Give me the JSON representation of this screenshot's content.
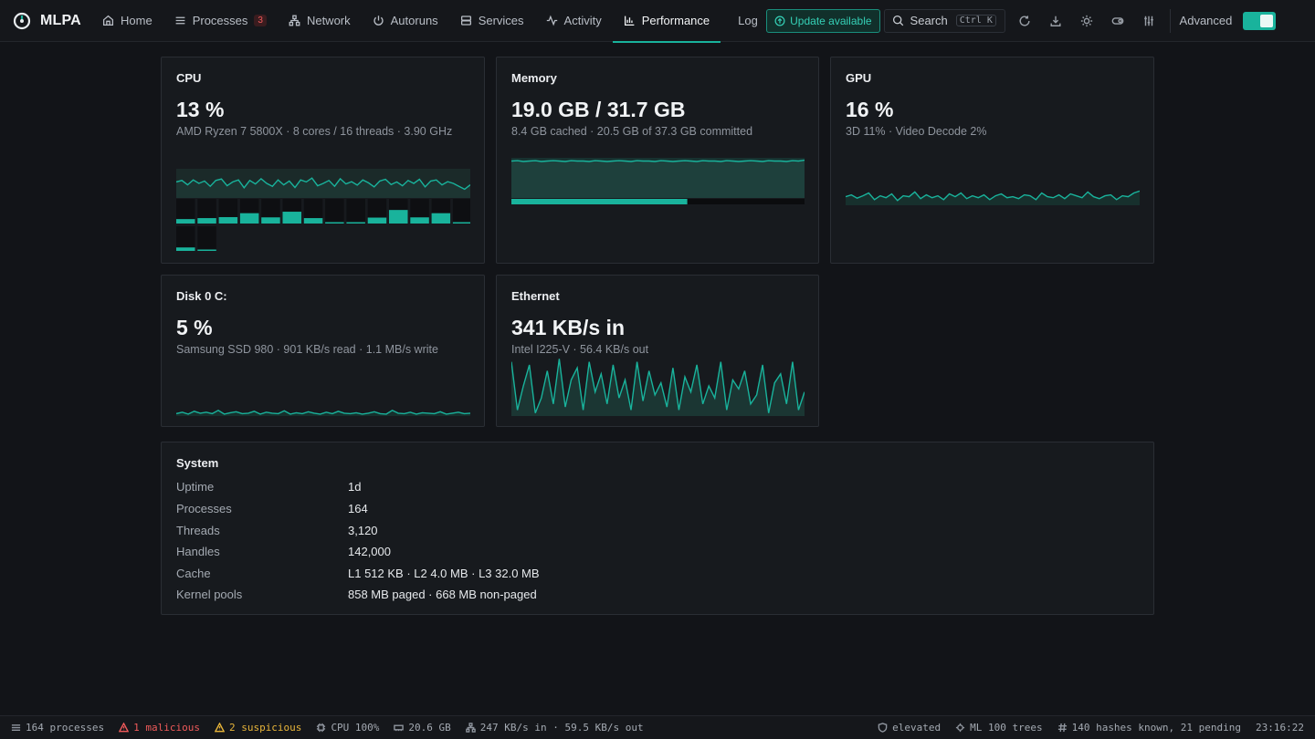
{
  "app": {
    "name": "MLPA"
  },
  "nav": {
    "items": [
      {
        "label": "Home",
        "icon": "home-icon"
      },
      {
        "label": "Processes",
        "icon": "list-icon",
        "badge": "3"
      },
      {
        "label": "Network",
        "icon": "network-icon"
      },
      {
        "label": "Autoruns",
        "icon": "power-icon"
      },
      {
        "label": "Services",
        "icon": "server-icon"
      },
      {
        "label": "Activity",
        "icon": "activity-icon"
      },
      {
        "label": "Performance",
        "icon": "bar-chart-icon",
        "active": true
      },
      {
        "label": "Log",
        "icon": "file-icon"
      }
    ],
    "update_label": "Update available",
    "search_label": "Search",
    "search_shortcut": "Ctrl K",
    "advanced_label": "Advanced",
    "advanced_enabled": true
  },
  "cards": {
    "cpu": {
      "title": "CPU",
      "value": "13 %",
      "subtitle": "AMD Ryzen 7 5800X · 8 cores / 16 threads · 3.90 GHz",
      "history": [
        0.55,
        0.6,
        0.45,
        0.62,
        0.5,
        0.58,
        0.4,
        0.6,
        0.65,
        0.42,
        0.55,
        0.62,
        0.35,
        0.6,
        0.48,
        0.66,
        0.5,
        0.4,
        0.62,
        0.45,
        0.58,
        0.36,
        0.62,
        0.55,
        0.68,
        0.42,
        0.5,
        0.6,
        0.4,
        0.66,
        0.48,
        0.56,
        0.44,
        0.62,
        0.52,
        0.38,
        0.58,
        0.64,
        0.46,
        0.55,
        0.42,
        0.6,
        0.5,
        0.64,
        0.38,
        0.58,
        0.62,
        0.45,
        0.56,
        0.5,
        0.4,
        0.3,
        0.45
      ],
      "core_loads": [
        0.18,
        0.22,
        0.26,
        0.42,
        0.25,
        0.48,
        0.22,
        0.02,
        0.02,
        0.24,
        0.55,
        0.25,
        0.42,
        0.04,
        0.14,
        0.04
      ]
    },
    "memory": {
      "title": "Memory",
      "value": "19.0 GB / 31.7 GB",
      "subtitle": "8.4 GB cached · 20.5 GB of 37.3 GB committed",
      "usage_fraction": 0.6,
      "history": [
        0.92,
        0.93,
        0.91,
        0.92,
        0.93,
        0.91,
        0.92,
        0.93,
        0.92,
        0.91,
        0.93,
        0.92,
        0.92,
        0.91,
        0.93,
        0.92,
        0.91,
        0.92,
        0.93,
        0.92,
        0.91,
        0.93,
        0.92,
        0.92,
        0.91,
        0.93,
        0.92,
        0.91,
        0.92,
        0.93,
        0.92,
        0.91,
        0.93,
        0.92,
        0.92,
        0.91,
        0.93,
        0.92,
        0.91,
        0.92,
        0.93,
        0.92,
        0.91,
        0.93,
        0.92,
        0.92,
        0.91,
        0.93,
        0.92,
        0.94
      ]
    },
    "gpu": {
      "title": "GPU",
      "value": "16 %",
      "subtitle": "3D 11% · Video Decode 2%",
      "history": [
        0.18,
        0.22,
        0.15,
        0.2,
        0.26,
        0.12,
        0.2,
        0.16,
        0.24,
        0.1,
        0.2,
        0.18,
        0.28,
        0.14,
        0.22,
        0.16,
        0.2,
        0.12,
        0.24,
        0.18,
        0.26,
        0.14,
        0.2,
        0.16,
        0.22,
        0.12,
        0.2,
        0.24,
        0.16,
        0.18,
        0.14,
        0.22,
        0.2,
        0.12,
        0.26,
        0.18,
        0.16,
        0.22,
        0.14,
        0.24,
        0.2,
        0.16,
        0.28,
        0.18,
        0.14,
        0.2,
        0.22,
        0.12,
        0.2,
        0.18,
        0.26,
        0.3
      ]
    },
    "disk": {
      "title": "Disk 0 C:",
      "value": "5 %",
      "subtitle": "Samsung SSD 980 · 901 KB/s read · 1.1 MB/s write",
      "history": [
        0.05,
        0.08,
        0.04,
        0.1,
        0.06,
        0.08,
        0.05,
        0.12,
        0.04,
        0.07,
        0.09,
        0.05,
        0.06,
        0.1,
        0.04,
        0.08,
        0.06,
        0.05,
        0.11,
        0.04,
        0.07,
        0.05,
        0.09,
        0.06,
        0.04,
        0.08,
        0.05,
        0.1,
        0.06,
        0.05,
        0.07,
        0.04,
        0.06,
        0.09,
        0.05,
        0.04,
        0.12,
        0.06,
        0.05,
        0.08,
        0.04,
        0.07,
        0.06,
        0.05,
        0.09,
        0.04,
        0.06,
        0.08,
        0.05,
        0.06
      ]
    },
    "ethernet": {
      "title": "Ethernet",
      "value": "341 KB/s in",
      "subtitle": "Intel I225-V · 56.4 KB/s out",
      "history": [
        0.9,
        0.1,
        0.5,
        0.85,
        0.05,
        0.3,
        0.75,
        0.2,
        0.95,
        0.15,
        0.6,
        0.8,
        0.1,
        0.9,
        0.4,
        0.7,
        0.2,
        0.85,
        0.3,
        0.6,
        0.1,
        0.9,
        0.25,
        0.75,
        0.35,
        0.55,
        0.15,
        0.8,
        0.1,
        0.65,
        0.4,
        0.85,
        0.2,
        0.5,
        0.3,
        0.9,
        0.1,
        0.6,
        0.45,
        0.75,
        0.2,
        0.35,
        0.85,
        0.05,
        0.55,
        0.7,
        0.2,
        0.9,
        0.1,
        0.4
      ]
    }
  },
  "system": {
    "title": "System",
    "rows": [
      {
        "label": "Uptime",
        "value": "1d"
      },
      {
        "label": "Processes",
        "value": "164"
      },
      {
        "label": "Threads",
        "value": "3,120"
      },
      {
        "label": "Handles",
        "value": "142,000"
      },
      {
        "label": "Cache",
        "value": "L1 512 KB · L2 4.0 MB · L3 32.0 MB"
      },
      {
        "label": "Kernel pools",
        "value": "858 MB paged · 668 MB non-paged"
      }
    ]
  },
  "status": {
    "processes": "164 processes",
    "malicious": "1 malicious",
    "suspicious": "2 suspicious",
    "cpu": "CPU 100%",
    "memory": "20.6 GB",
    "network": "247 KB/s in · 59.5 KB/s out",
    "elevated": "elevated",
    "ml": "ML 100 trees",
    "hashes": "140 hashes known, 21 pending",
    "time": "23:16:22"
  },
  "colors": {
    "accent": "#19b39c",
    "danger": "#ef5a5a",
    "warning": "#e8b53a"
  }
}
